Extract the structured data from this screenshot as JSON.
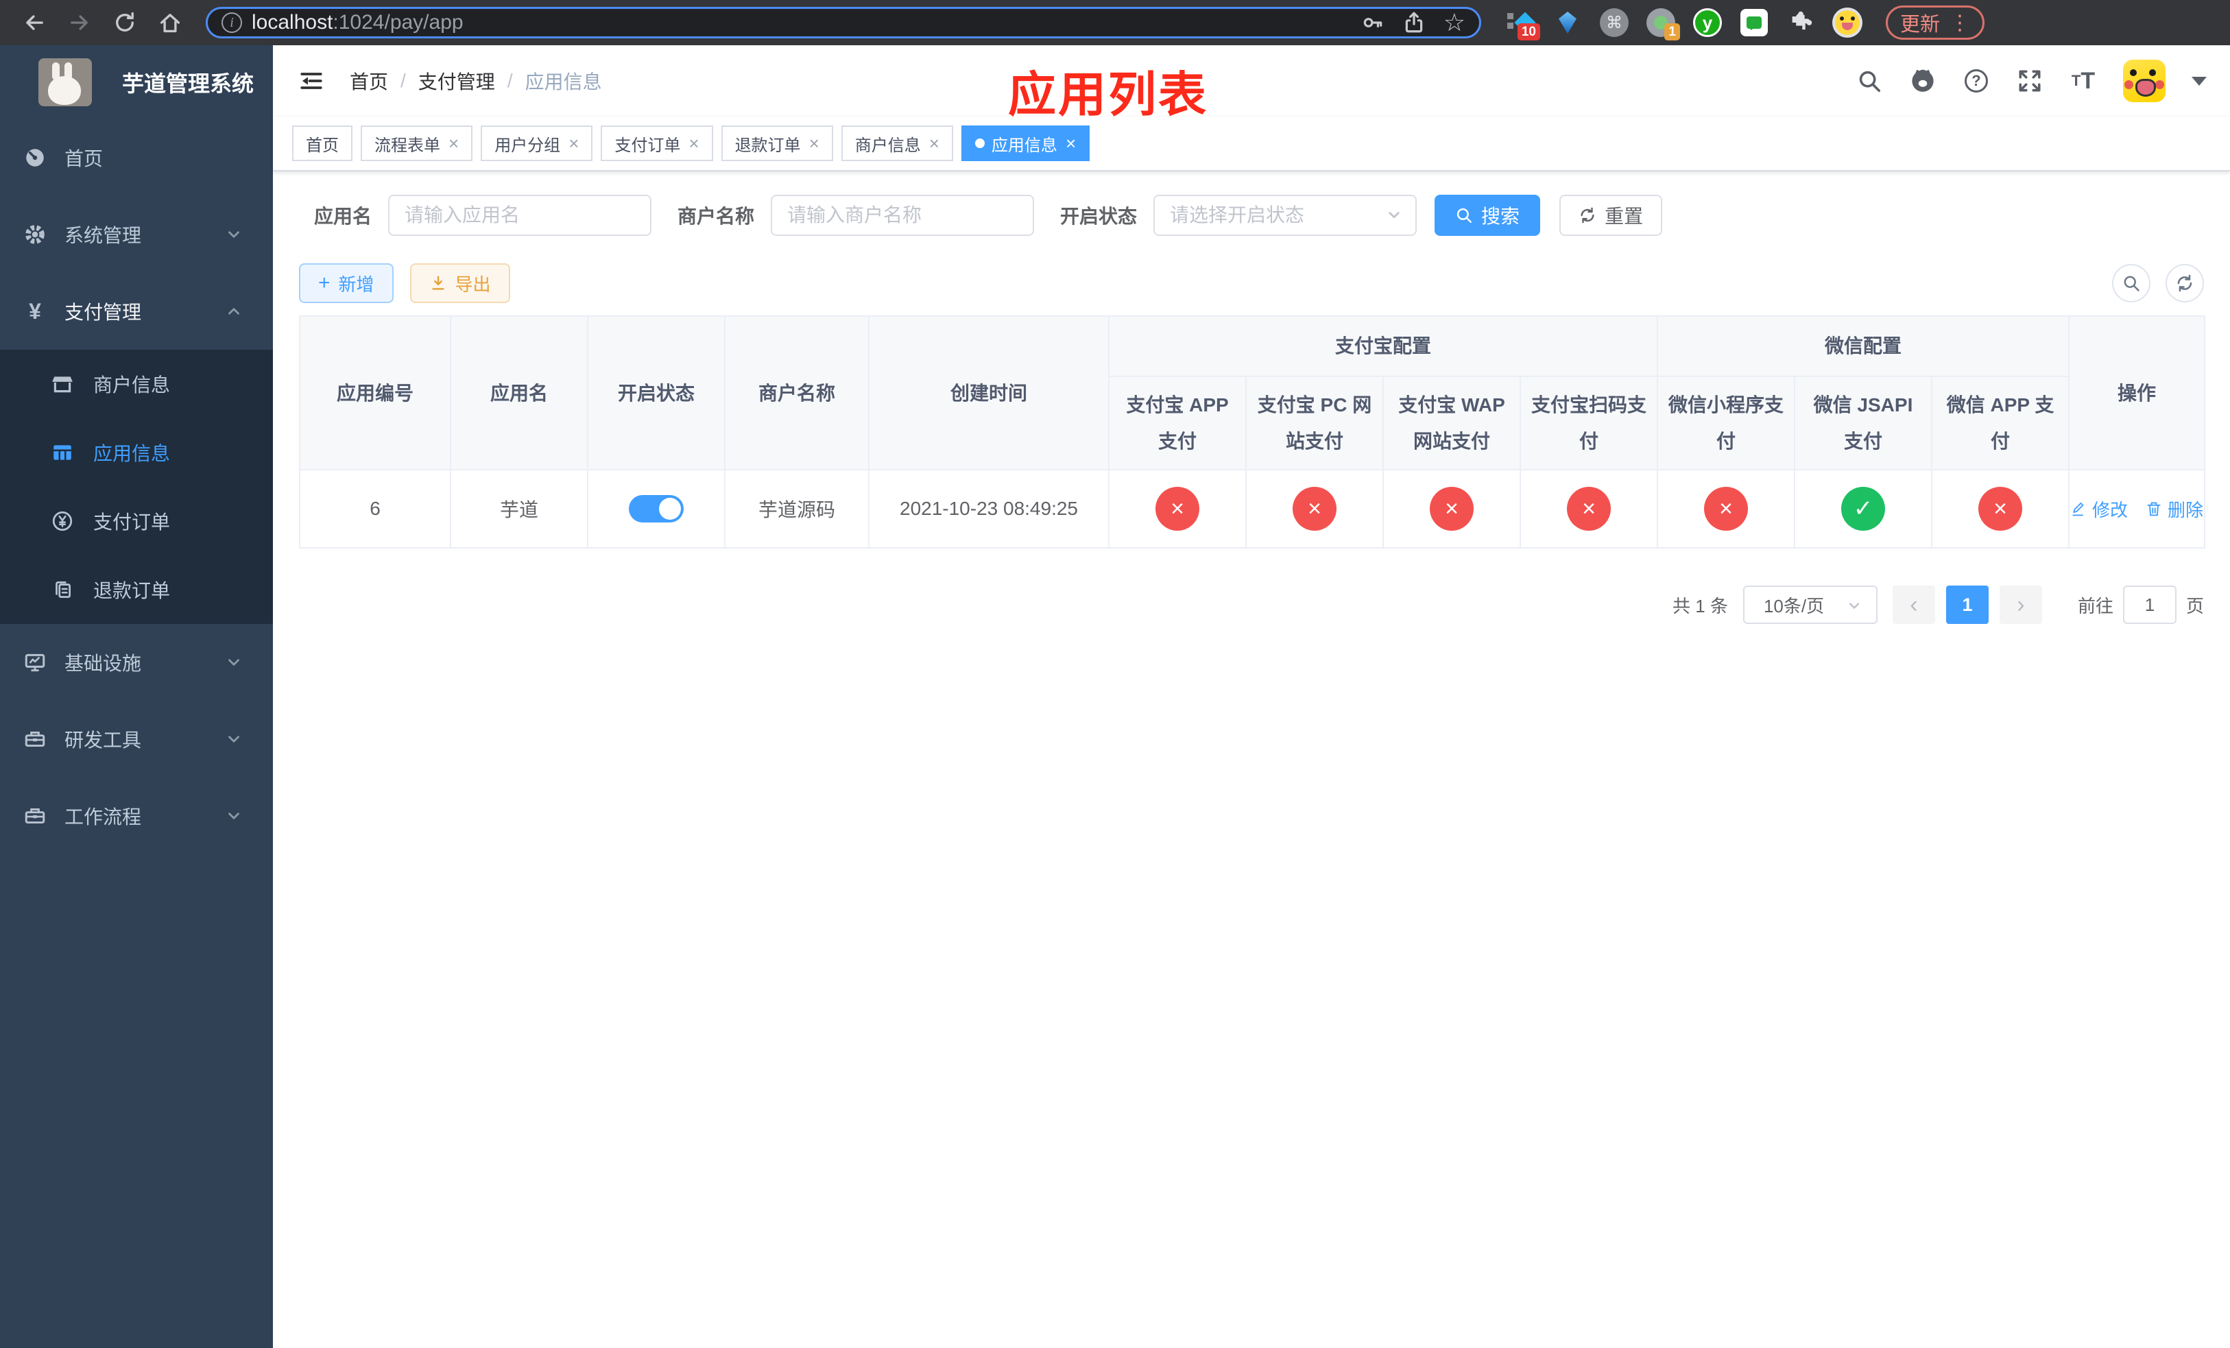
{
  "colors": {
    "accent": "#409eff",
    "danger": "#f3514f",
    "success": "#1dbf63",
    "warning": "#e6a23c",
    "sidebar-bg": "#304156",
    "submenu-bg": "#1f2d3d",
    "annotation": "#fb2a1a"
  },
  "icons": {
    "close": "×",
    "prev": "‹",
    "next": "›",
    "status_no": "×",
    "status_yes": "✓",
    "info": "i",
    "question": "?",
    "command": "⌘",
    "star": "☆",
    "plus": "+",
    "yen": "¥",
    "menu_dots": "⋮"
  },
  "browser": {
    "url_host": "localhost",
    "url_path": ":1024/pay/app",
    "update_label": "更新",
    "ext_badge_blocks": "10",
    "ext_badge_camera": "1",
    "ext_y_letter": "y"
  },
  "sidebar": {
    "title": "芋道管理系统",
    "items": [
      {
        "label": "首页"
      },
      {
        "label": "系统管理"
      },
      {
        "label": "支付管理"
      },
      {
        "label": "商户信息"
      },
      {
        "label": "应用信息"
      },
      {
        "label": "支付订单"
      },
      {
        "label": "退款订单"
      },
      {
        "label": "基础设施"
      },
      {
        "label": "研发工具"
      },
      {
        "label": "工作流程"
      }
    ]
  },
  "navbar": {
    "breadcrumb": [
      "首页",
      "支付管理",
      "应用信息"
    ],
    "separator": "/"
  },
  "annotation": {
    "text": "应用列表"
  },
  "tabs": [
    {
      "label": "首页"
    },
    {
      "label": "流程表单"
    },
    {
      "label": "用户分组"
    },
    {
      "label": "支付订单"
    },
    {
      "label": "退款订单"
    },
    {
      "label": "商户信息"
    },
    {
      "label": "应用信息"
    }
  ],
  "filters": {
    "app_name_label": "应用名",
    "app_name_placeholder": "请输入应用名",
    "merchant_label": "商户名称",
    "merchant_placeholder": "请输入商户名称",
    "status_label": "开启状态",
    "status_placeholder": "请选择开启状态",
    "search_label": "搜索",
    "reset_label": "重置"
  },
  "toolbar": {
    "add_label": "新增",
    "export_label": "导出"
  },
  "table": {
    "headers": {
      "app_id": "应用编号",
      "app_name": "应用名",
      "open_status": "开启状态",
      "merchant_name": "商户名称",
      "create_time": "创建时间",
      "alipay_group": "支付宝配置",
      "wechat_group": "微信配置",
      "actions": "操作"
    },
    "sub_headers": [
      "支付宝 APP 支付",
      "支付宝 PC 网站支付",
      "支付宝 WAP 网站支付",
      "支付宝扫码支付",
      "微信小程序支付",
      "微信 JSAPI 支付",
      "微信 APP 支付"
    ],
    "row": {
      "app_id": "6",
      "app_name": "芋道",
      "enabled": true,
      "merchant_name": "芋道源码",
      "create_time": "2021-10-23 08:49:25",
      "statuses": [
        "no",
        "no",
        "no",
        "no",
        "no",
        "yes",
        "no"
      ],
      "edit_label": "修改",
      "delete_label": "删除"
    }
  },
  "pagination": {
    "total_text": "共 1 条",
    "page_size": "10条/页",
    "current_page": "1",
    "goto_label": "前往",
    "goto_value": "1",
    "page_unit": "页"
  }
}
